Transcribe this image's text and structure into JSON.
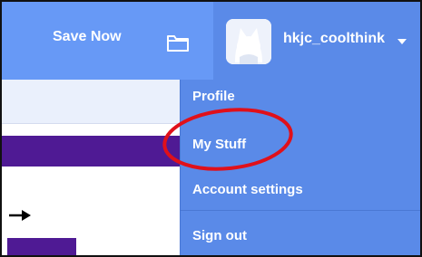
{
  "toolbar": {
    "save_label": "Save Now",
    "folder_icon": "folder-icon"
  },
  "account": {
    "username": "hkjc_coolthink",
    "avatar_icon": "cat-avatar",
    "caret_icon": "caret-down-icon"
  },
  "menu": {
    "items": [
      {
        "label": "Profile"
      },
      {
        "label": "My Stuff"
      },
      {
        "label": "Account settings"
      },
      {
        "label": "Sign out"
      }
    ]
  },
  "colors": {
    "topbar": "#6799f6",
    "menu": "#5a8ae8",
    "accent_purple": "#4f1a94",
    "annotation_red": "#e0101a"
  }
}
